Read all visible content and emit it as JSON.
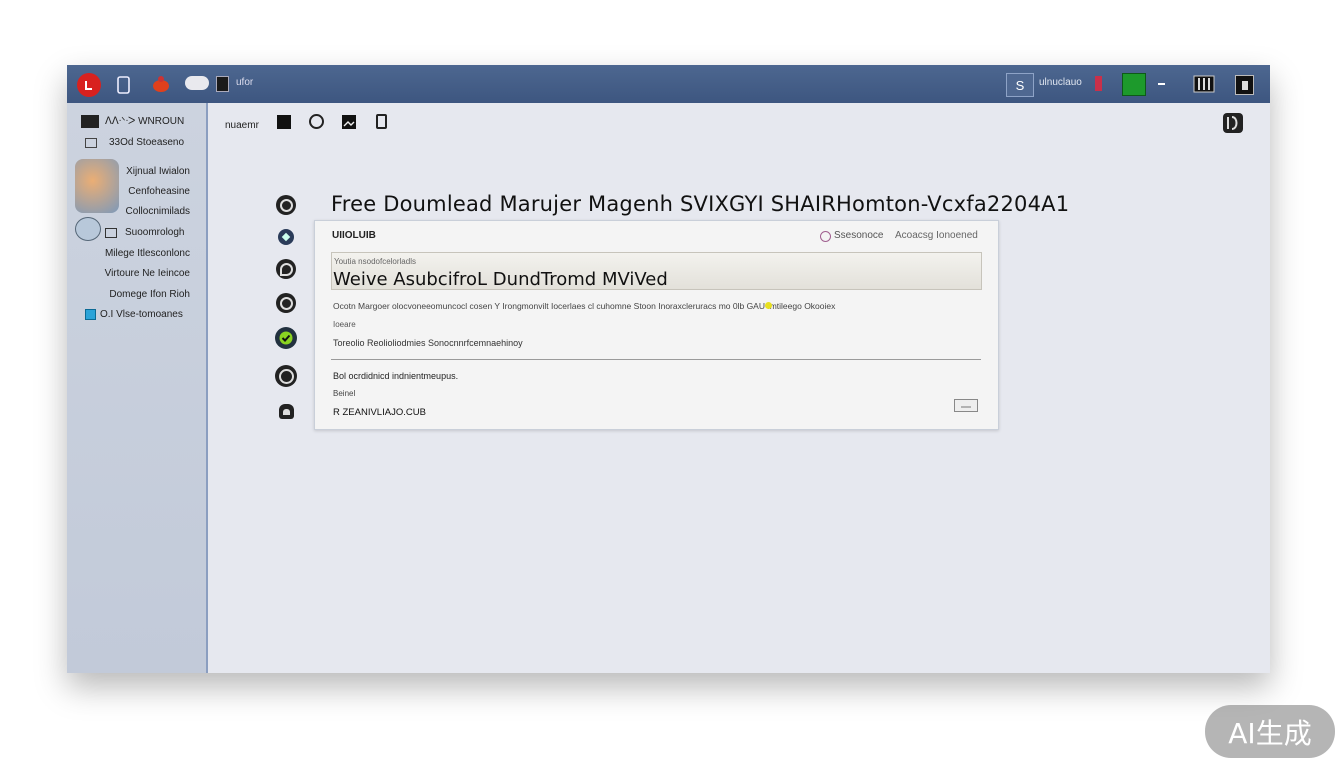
{
  "titlebar": {
    "left_label": "ufor",
    "status_text": "ulnuclauo",
    "right_button_label": "S",
    "icons": [
      "app-record-icon",
      "page-icon",
      "bug-icon",
      "cloud-icon",
      "small-square-icon",
      "script-icon",
      "flag-icon",
      "green-block-icon",
      "dash-icon",
      "columns-icon",
      "square-icon"
    ],
    "accent": "#41598a"
  },
  "sidebar": {
    "header_title": "ᐱᐱᐧᐠᐧᐳ WNROUN",
    "header_sub": "33Od Stoeaseno",
    "items": [
      {
        "label": "Xijnual Iwialon"
      },
      {
        "label": "Cenfoheasine"
      },
      {
        "label": "Collocnimilads"
      },
      {
        "label": "Suoomrologh"
      },
      {
        "label": "Milege Itlesconlonc"
      },
      {
        "label": "Virtoure Ne Ieincoe"
      },
      {
        "label": "Domege Ifon Rioh"
      },
      {
        "label": "O.I Vlse-tomoanes"
      }
    ]
  },
  "toolbar": {
    "label": "nuaemr",
    "icons": [
      "stop-icon",
      "download-icon",
      "image-icon",
      "document-icon"
    ]
  },
  "main": {
    "title": "Free Doumlead Marujer Magenh SVIXGYI SHAIRHomton-Vcxfa2204A1",
    "steps": [
      "circle-icon",
      "diamond-icon",
      "drop-icon",
      "circle-icon",
      "check-icon",
      "circle-icon",
      "bell-icon"
    ]
  },
  "card": {
    "header_left": "UIIOLUIB",
    "header_status": "Ssesonoce",
    "header_right": "Acoacsg Ionoened",
    "field_label": "Youtia nsodofcelorladls",
    "field_value": "Weive AsubcifroL DundTromd MViVed",
    "desc": "Ocotn Margoer olocvoneeomuncocl cosen Y Irongmonvilt Iocerlaes cl cuhomne Stoon Inoraxcleruracs mo 0lb GAU Imtileego Okooiex",
    "desc_extra": "Ioeare",
    "line2": "Toreolio Reolioliodmies Sonocnnrfcemnaehinoy",
    "info1": "Bol ocrdidnicd indnientmeupus.",
    "info2": "Beinel",
    "info3": "R ZEANIVLIAJO.CUB"
  },
  "watermark": {
    "text": "AI生成"
  }
}
